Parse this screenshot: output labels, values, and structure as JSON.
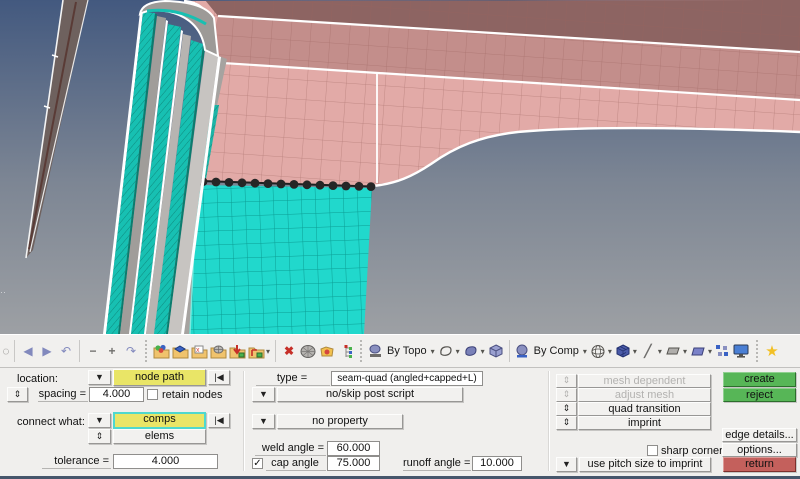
{
  "icons": {
    "dropdown": "▼",
    "updown": "⇕",
    "reverse": "|◀",
    "check": "✓",
    "back": "◀",
    "forward": "▶",
    "undo": "↶",
    "redo": "↷",
    "minus": "−",
    "plus": "+",
    "delete": "✖",
    "slash": "╱",
    "star": "★"
  },
  "colors": {
    "background_top": "#43597f",
    "background_bottom": "#9da0a4",
    "pink_mesh": "#e2aaa7",
    "pink_mid_band": "#c38e8b",
    "pink_dark_band": "#8d6462",
    "cyan_mesh": "#21d8cc",
    "teal_flange": "#17c0b2",
    "accent_yellow": "#e9e567",
    "accent_green": "#57b657",
    "accent_red": "#c4605c",
    "focus_cyan": "#4fd8ce"
  },
  "toolbar": {
    "by_topo_label": "By Topo",
    "by_comp_label": "By Comp"
  },
  "panel": {
    "location_label": "location:",
    "location_entity": "node path",
    "spacing_label": "spacing =",
    "spacing_value": "4.000",
    "retain_nodes_label": "retain nodes",
    "connect_label": "connect what:",
    "connect_entity": "comps",
    "connect_sub_entity": "elems",
    "tolerance_label": "tolerance =",
    "tolerance_value": "4.000",
    "type_label": "type =",
    "type_value": "seam-quad (angled+capped+L)",
    "post_script_label": "no/skip post script",
    "property_label": "no property",
    "weld_angle_label": "weld angle =",
    "weld_angle_value": "60.000",
    "cap_angle_label": "cap angle",
    "cap_angle_value": "75.000",
    "runoff_angle_label": "runoff angle =",
    "runoff_angle_value": "10.000",
    "mesh_dependent_label": "mesh dependent",
    "adjust_mesh_label": "adjust mesh",
    "quad_transition_label": "quad transition",
    "imprint_label": "imprint",
    "create_label": "create",
    "reject_label": "reject",
    "edge_details_label": "edge details...",
    "sharp_corner_label": "sharp corner",
    "options_label": "options...",
    "pitch_label": "use pitch size to imprint",
    "return_label": "return"
  }
}
